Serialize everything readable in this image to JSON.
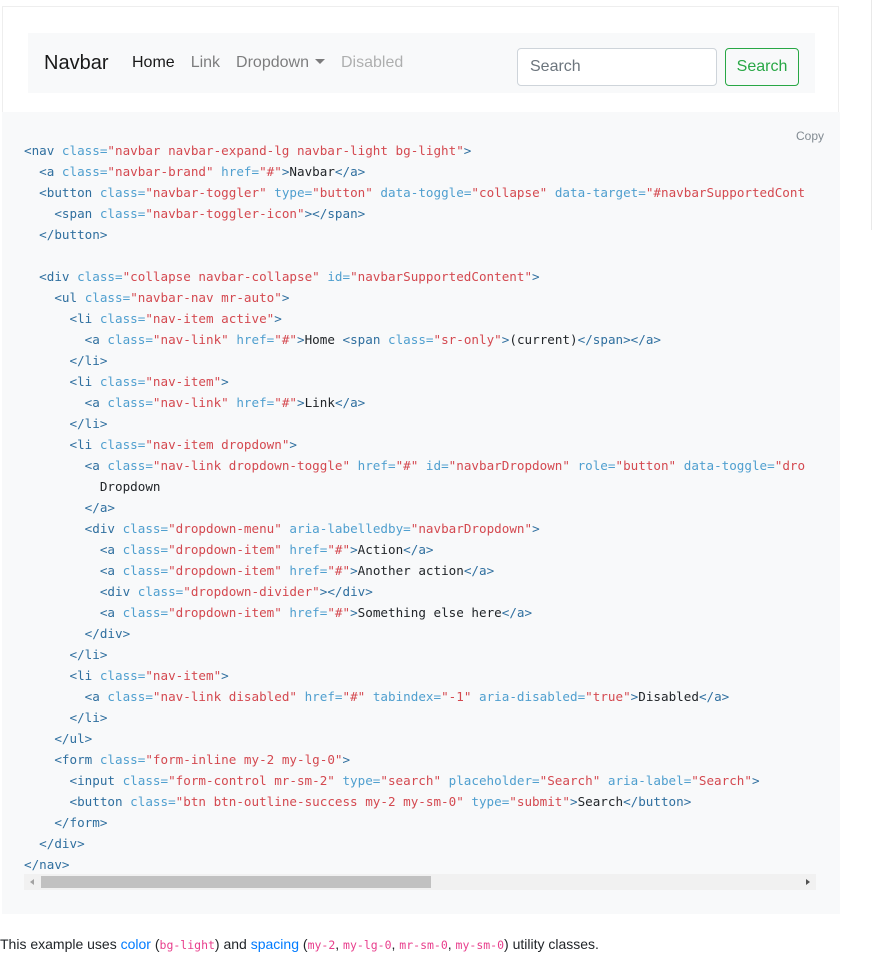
{
  "navbar": {
    "brand": "Navbar",
    "links": [
      {
        "label": "Home",
        "state": "active"
      },
      {
        "label": "Link",
        "state": "normal"
      },
      {
        "label": "Dropdown",
        "state": "dropdown"
      },
      {
        "label": "Disabled",
        "state": "disabled"
      }
    ],
    "search_placeholder": "Search",
    "search_button": "Search"
  },
  "code_block": {
    "copy_label": "Copy",
    "lines": [
      [
        [
          "tag",
          "<nav "
        ],
        [
          "attr",
          "class="
        ],
        [
          "str",
          "\"navbar navbar-expand-lg navbar-light bg-light\""
        ],
        [
          "tag",
          ">"
        ]
      ],
      [
        [
          "txt",
          "  "
        ],
        [
          "tag",
          "<a "
        ],
        [
          "attr",
          "class="
        ],
        [
          "str",
          "\"navbar-brand\" "
        ],
        [
          "attr",
          "href="
        ],
        [
          "str",
          "\"#\""
        ],
        [
          "tag",
          ">"
        ],
        [
          "txt",
          "Navbar"
        ],
        [
          "tag",
          "</a>"
        ]
      ],
      [
        [
          "txt",
          "  "
        ],
        [
          "tag",
          "<button "
        ],
        [
          "attr",
          "class="
        ],
        [
          "str",
          "\"navbar-toggler\" "
        ],
        [
          "attr",
          "type="
        ],
        [
          "str",
          "\"button\" "
        ],
        [
          "attr",
          "data-toggle="
        ],
        [
          "str",
          "\"collapse\" "
        ],
        [
          "attr",
          "data-target="
        ],
        [
          "str",
          "\"#navbarSupportedCont"
        ]
      ],
      [
        [
          "txt",
          "    "
        ],
        [
          "tag",
          "<span "
        ],
        [
          "attr",
          "class="
        ],
        [
          "str",
          "\"navbar-toggler-icon\""
        ],
        [
          "tag",
          "></span>"
        ]
      ],
      [
        [
          "txt",
          "  "
        ],
        [
          "tag",
          "</button>"
        ]
      ],
      [
        [
          "txt",
          ""
        ]
      ],
      [
        [
          "txt",
          "  "
        ],
        [
          "tag",
          "<div "
        ],
        [
          "attr",
          "class="
        ],
        [
          "str",
          "\"collapse navbar-collapse\" "
        ],
        [
          "attr",
          "id="
        ],
        [
          "str",
          "\"navbarSupportedContent\""
        ],
        [
          "tag",
          ">"
        ]
      ],
      [
        [
          "txt",
          "    "
        ],
        [
          "tag",
          "<ul "
        ],
        [
          "attr",
          "class="
        ],
        [
          "str",
          "\"navbar-nav mr-auto\""
        ],
        [
          "tag",
          ">"
        ]
      ],
      [
        [
          "txt",
          "      "
        ],
        [
          "tag",
          "<li "
        ],
        [
          "attr",
          "class="
        ],
        [
          "str",
          "\"nav-item active\""
        ],
        [
          "tag",
          ">"
        ]
      ],
      [
        [
          "txt",
          "        "
        ],
        [
          "tag",
          "<a "
        ],
        [
          "attr",
          "class="
        ],
        [
          "str",
          "\"nav-link\" "
        ],
        [
          "attr",
          "href="
        ],
        [
          "str",
          "\"#\""
        ],
        [
          "tag",
          ">"
        ],
        [
          "txt",
          "Home "
        ],
        [
          "tag",
          "<span "
        ],
        [
          "attr",
          "class="
        ],
        [
          "str",
          "\"sr-only\""
        ],
        [
          "tag",
          ">"
        ],
        [
          "txt",
          "(current)"
        ],
        [
          "tag",
          "</span></a>"
        ]
      ],
      [
        [
          "txt",
          "      "
        ],
        [
          "tag",
          "</li>"
        ]
      ],
      [
        [
          "txt",
          "      "
        ],
        [
          "tag",
          "<li "
        ],
        [
          "attr",
          "class="
        ],
        [
          "str",
          "\"nav-item\""
        ],
        [
          "tag",
          ">"
        ]
      ],
      [
        [
          "txt",
          "        "
        ],
        [
          "tag",
          "<a "
        ],
        [
          "attr",
          "class="
        ],
        [
          "str",
          "\"nav-link\" "
        ],
        [
          "attr",
          "href="
        ],
        [
          "str",
          "\"#\""
        ],
        [
          "tag",
          ">"
        ],
        [
          "txt",
          "Link"
        ],
        [
          "tag",
          "</a>"
        ]
      ],
      [
        [
          "txt",
          "      "
        ],
        [
          "tag",
          "</li>"
        ]
      ],
      [
        [
          "txt",
          "      "
        ],
        [
          "tag",
          "<li "
        ],
        [
          "attr",
          "class="
        ],
        [
          "str",
          "\"nav-item dropdown\""
        ],
        [
          "tag",
          ">"
        ]
      ],
      [
        [
          "txt",
          "        "
        ],
        [
          "tag",
          "<a "
        ],
        [
          "attr",
          "class="
        ],
        [
          "str",
          "\"nav-link dropdown-toggle\" "
        ],
        [
          "attr",
          "href="
        ],
        [
          "str",
          "\"#\" "
        ],
        [
          "attr",
          "id="
        ],
        [
          "str",
          "\"navbarDropdown\" "
        ],
        [
          "attr",
          "role="
        ],
        [
          "str",
          "\"button\" "
        ],
        [
          "attr",
          "data-toggle="
        ],
        [
          "str",
          "\"dro"
        ]
      ],
      [
        [
          "txt",
          "          Dropdown"
        ]
      ],
      [
        [
          "txt",
          "        "
        ],
        [
          "tag",
          "</a>"
        ]
      ],
      [
        [
          "txt",
          "        "
        ],
        [
          "tag",
          "<div "
        ],
        [
          "attr",
          "class="
        ],
        [
          "str",
          "\"dropdown-menu\" "
        ],
        [
          "attr",
          "aria-labelledby="
        ],
        [
          "str",
          "\"navbarDropdown\""
        ],
        [
          "tag",
          ">"
        ]
      ],
      [
        [
          "txt",
          "          "
        ],
        [
          "tag",
          "<a "
        ],
        [
          "attr",
          "class="
        ],
        [
          "str",
          "\"dropdown-item\" "
        ],
        [
          "attr",
          "href="
        ],
        [
          "str",
          "\"#\""
        ],
        [
          "tag",
          ">"
        ],
        [
          "txt",
          "Action"
        ],
        [
          "tag",
          "</a>"
        ]
      ],
      [
        [
          "txt",
          "          "
        ],
        [
          "tag",
          "<a "
        ],
        [
          "attr",
          "class="
        ],
        [
          "str",
          "\"dropdown-item\" "
        ],
        [
          "attr",
          "href="
        ],
        [
          "str",
          "\"#\""
        ],
        [
          "tag",
          ">"
        ],
        [
          "txt",
          "Another action"
        ],
        [
          "tag",
          "</a>"
        ]
      ],
      [
        [
          "txt",
          "          "
        ],
        [
          "tag",
          "<div "
        ],
        [
          "attr",
          "class="
        ],
        [
          "str",
          "\"dropdown-divider\""
        ],
        [
          "tag",
          "></div>"
        ]
      ],
      [
        [
          "txt",
          "          "
        ],
        [
          "tag",
          "<a "
        ],
        [
          "attr",
          "class="
        ],
        [
          "str",
          "\"dropdown-item\" "
        ],
        [
          "attr",
          "href="
        ],
        [
          "str",
          "\"#\""
        ],
        [
          "tag",
          ">"
        ],
        [
          "txt",
          "Something else here"
        ],
        [
          "tag",
          "</a>"
        ]
      ],
      [
        [
          "txt",
          "        "
        ],
        [
          "tag",
          "</div>"
        ]
      ],
      [
        [
          "txt",
          "      "
        ],
        [
          "tag",
          "</li>"
        ]
      ],
      [
        [
          "txt",
          "      "
        ],
        [
          "tag",
          "<li "
        ],
        [
          "attr",
          "class="
        ],
        [
          "str",
          "\"nav-item\""
        ],
        [
          "tag",
          ">"
        ]
      ],
      [
        [
          "txt",
          "        "
        ],
        [
          "tag",
          "<a "
        ],
        [
          "attr",
          "class="
        ],
        [
          "str",
          "\"nav-link disabled\" "
        ],
        [
          "attr",
          "href="
        ],
        [
          "str",
          "\"#\" "
        ],
        [
          "attr",
          "tabindex="
        ],
        [
          "str",
          "\"-1\" "
        ],
        [
          "attr",
          "aria-disabled="
        ],
        [
          "str",
          "\"true\""
        ],
        [
          "tag",
          ">"
        ],
        [
          "txt",
          "Disabled"
        ],
        [
          "tag",
          "</a>"
        ]
      ],
      [
        [
          "txt",
          "      "
        ],
        [
          "tag",
          "</li>"
        ]
      ],
      [
        [
          "txt",
          "    "
        ],
        [
          "tag",
          "</ul>"
        ]
      ],
      [
        [
          "txt",
          "    "
        ],
        [
          "tag",
          "<form "
        ],
        [
          "attr",
          "class="
        ],
        [
          "str",
          "\"form-inline my-2 my-lg-0\""
        ],
        [
          "tag",
          ">"
        ]
      ],
      [
        [
          "txt",
          "      "
        ],
        [
          "tag",
          "<input "
        ],
        [
          "attr",
          "class="
        ],
        [
          "str",
          "\"form-control mr-sm-2\" "
        ],
        [
          "attr",
          "type="
        ],
        [
          "str",
          "\"search\" "
        ],
        [
          "attr",
          "placeholder="
        ],
        [
          "str",
          "\"Search\" "
        ],
        [
          "attr",
          "aria-label="
        ],
        [
          "str",
          "\"Search\""
        ],
        [
          "tag",
          ">"
        ]
      ],
      [
        [
          "txt",
          "      "
        ],
        [
          "tag",
          "<button "
        ],
        [
          "attr",
          "class="
        ],
        [
          "str",
          "\"btn btn-outline-success my-2 my-sm-0\" "
        ],
        [
          "attr",
          "type="
        ],
        [
          "str",
          "\"submit\""
        ],
        [
          "tag",
          ">"
        ],
        [
          "txt",
          "Search"
        ],
        [
          "tag",
          "</button>"
        ]
      ],
      [
        [
          "txt",
          "    "
        ],
        [
          "tag",
          "</form>"
        ]
      ],
      [
        [
          "txt",
          "  "
        ],
        [
          "tag",
          "</div>"
        ]
      ],
      [
        [
          "tag",
          "</nav>"
        ]
      ]
    ]
  },
  "description": {
    "prefix": "This example uses ",
    "link1": "color",
    "open1": " (",
    "code1": "bg-light",
    "mid": ") and ",
    "link2": "spacing",
    "open2": " (",
    "code2": "my-2",
    "sep1": ", ",
    "code3": "my-lg-0",
    "sep2": ", ",
    "code4": "mr-sm-0",
    "sep3": ", ",
    "code5": "my-sm-0",
    "suffix": ") utility classes."
  },
  "colors": {
    "tag": "#2f6f9f",
    "attr": "#4f9fcf",
    "string": "#d44950",
    "success": "#28a745",
    "link": "#007bff",
    "inline_code": "#e83e8c"
  },
  "scrollbar": {
    "horizontal_position_fraction": 0.0
  }
}
